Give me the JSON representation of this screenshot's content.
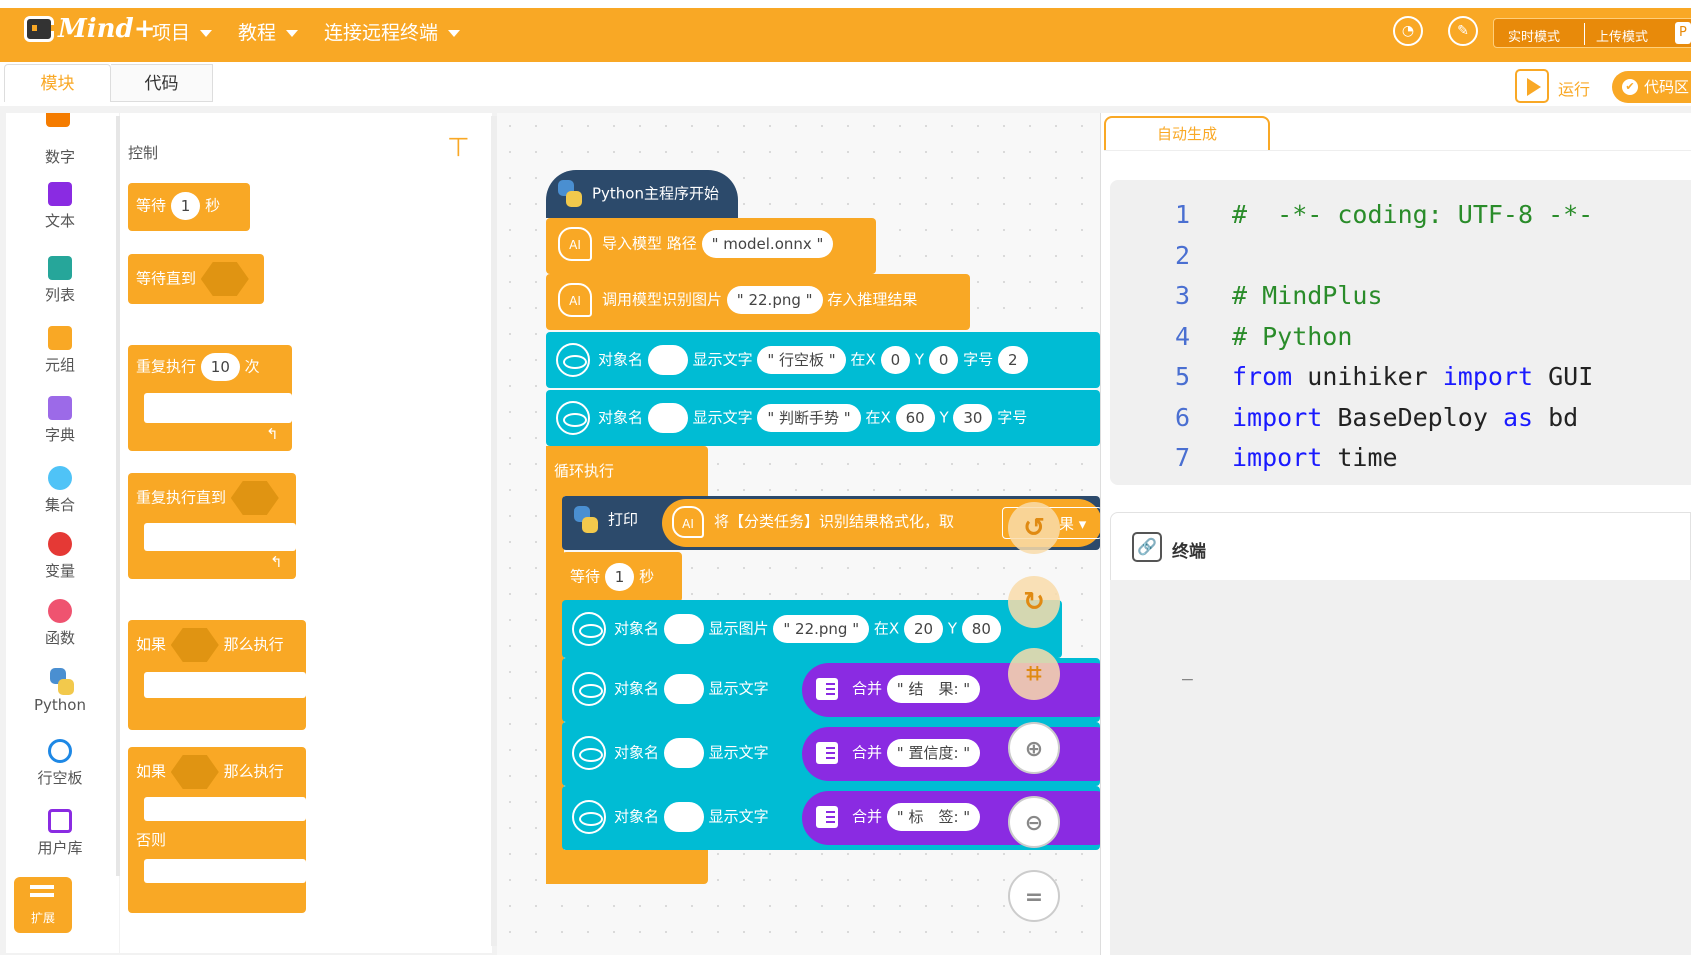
{
  "topbar": {
    "logo": "Mind+",
    "menus": [
      {
        "label": "项目"
      },
      {
        "label": "教程"
      },
      {
        "label": "连接远程终端"
      }
    ],
    "modes": {
      "realtime": "实时模式",
      "upload": "上传模式",
      "python": "P"
    }
  },
  "tabs": {
    "blocks": "模块",
    "code": "代码"
  },
  "toolbar": {
    "run": "运行",
    "code_area": "代码区"
  },
  "categories": [
    {
      "label": "数字",
      "color": "#f57c00"
    },
    {
      "label": "文本",
      "color": "#8a2be2"
    },
    {
      "label": "列表",
      "color": "#26a69a"
    },
    {
      "label": "元组",
      "color": "#f9a825"
    },
    {
      "label": "字典",
      "color": "#9c6ae8"
    },
    {
      "label": "集合",
      "color": "#4fc3f7"
    },
    {
      "label": "变量",
      "color": "#e53935"
    },
    {
      "label": "函数",
      "color": "#ef5370"
    },
    {
      "label": "Python",
      "color": "#4a8fd1"
    },
    {
      "label": "行空板",
      "color": "#1e88e5"
    },
    {
      "label": "用户库",
      "color": "#8a2be2"
    }
  ],
  "extend_label": "扩展",
  "palette": {
    "title": "控制",
    "wait": {
      "text": "等待",
      "value": "1",
      "unit": "秒"
    },
    "wait_until": "等待直到",
    "repeat": {
      "text": "重复执行",
      "value": "10",
      "unit": "次"
    },
    "repeat_until": "重复执行直到",
    "if_then": {
      "if": "如果",
      "then": "那么执行"
    },
    "if_else": {
      "if": "如果",
      "then": "那么执行",
      "else": "否则"
    }
  },
  "workspace": {
    "start": "Python主程序开始",
    "import_model": {
      "text": "导入模型 路径",
      "value": "\" model.onnx \""
    },
    "infer": {
      "text": "调用模型识别图片",
      "value": "\" 22.png \"",
      "suffix": "存入推理结果"
    },
    "text1": {
      "obj": "对象名",
      "show": "显示文字",
      "value": "\" 行空板 \"",
      "x_label": "在X",
      "x": "0",
      "y_label": "Y",
      "y": "0",
      "size": "字号",
      "size_val": "2"
    },
    "text2": {
      "obj": "对象名",
      "show": "显示文字",
      "value": "\" 判断手势 \"",
      "x_label": "在X",
      "x": "60",
      "y_label": "Y",
      "y": "30",
      "size": "字号"
    },
    "loop": "循环执行",
    "print": {
      "text": "打印",
      "content": "将【分类任务】识别结果格式化，取",
      "select": "果"
    },
    "wait": {
      "text": "等待",
      "value": "1",
      "unit": "秒"
    },
    "img": {
      "obj": "对象名",
      "show": "显示图片",
      "value": "\" 22.png \"",
      "x_label": "在X",
      "x": "20",
      "y_label": "Y",
      "y": "80"
    },
    "rows": [
      {
        "obj": "对象名",
        "show": "显示文字",
        "join": "合并",
        "value": "\" 结　果: \""
      },
      {
        "obj": "对象名",
        "show": "显示文字",
        "join": "合并",
        "value": "\" 置信度: \""
      },
      {
        "obj": "对象名",
        "show": "显示文字",
        "join": "合并",
        "value": "\" 标　签: \""
      }
    ]
  },
  "code": {
    "tab": "自动生成",
    "lines": [
      {
        "n": "1",
        "parts": [
          {
            "t": "#  -*- coding: UTF-8 -*-",
            "c": "cm"
          }
        ]
      },
      {
        "n": "2",
        "parts": []
      },
      {
        "n": "3",
        "parts": [
          {
            "t": "# MindPlus",
            "c": "cm"
          }
        ]
      },
      {
        "n": "4",
        "parts": [
          {
            "t": "# Python",
            "c": "cm"
          }
        ]
      },
      {
        "n": "5",
        "parts": [
          {
            "t": "from",
            "c": "kw"
          },
          {
            "t": " unihiker ",
            "c": ""
          },
          {
            "t": "import",
            "c": "kw"
          },
          {
            "t": " GUI",
            "c": ""
          }
        ]
      },
      {
        "n": "6",
        "parts": [
          {
            "t": "import",
            "c": "kw"
          },
          {
            "t": " BaseDeploy ",
            "c": ""
          },
          {
            "t": "as",
            "c": "kw"
          },
          {
            "t": " bd",
            "c": ""
          }
        ]
      },
      {
        "n": "7",
        "parts": [
          {
            "t": "import",
            "c": "kw"
          },
          {
            "t": " time",
            "c": ""
          }
        ]
      }
    ]
  },
  "terminal": {
    "title": "终端",
    "cursor": "_"
  }
}
